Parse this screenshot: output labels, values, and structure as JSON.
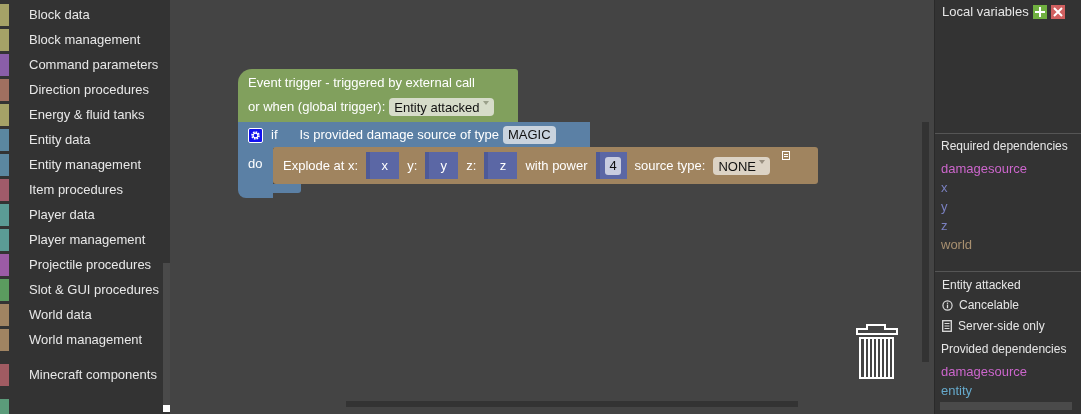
{
  "sidebar": {
    "groups": [
      {
        "categories": [
          {
            "label": "Block data",
            "color": "#a5a267"
          },
          {
            "label": "Block management",
            "color": "#a5a267"
          },
          {
            "label": "Command parameters",
            "color": "#8a5ea8"
          },
          {
            "label": "Direction procedures",
            "color": "#a07060"
          },
          {
            "label": "Energy & fluid tanks",
            "color": "#a5a267"
          },
          {
            "label": "Entity data",
            "color": "#5b87a0"
          },
          {
            "label": "Entity management",
            "color": "#5b87a0"
          },
          {
            "label": "Item procedures",
            "color": "#a05b6a"
          },
          {
            "label": "Player data",
            "color": "#5b9b95"
          },
          {
            "label": "Player management",
            "color": "#5b9b95"
          },
          {
            "label": "Projectile procedures",
            "color": "#9b5ba5"
          },
          {
            "label": "Slot & GUI procedures",
            "color": "#5b9b5f"
          },
          {
            "label": "World data",
            "color": "#a08462"
          },
          {
            "label": "World management",
            "color": "#a08462"
          }
        ]
      },
      {
        "categories": [
          {
            "label": "Minecraft components",
            "color": "#a05b62"
          }
        ]
      },
      {
        "categories": [
          {
            "color": "#5b9b7a"
          }
        ]
      }
    ]
  },
  "canvas": {
    "event_block": {
      "lines": [
        "Event trigger - triggered by external call",
        "or when (global trigger):"
      ],
      "trigger": "Entity attacked"
    },
    "if_block": {
      "keyword_if": "if",
      "condition": "Is provided damage source of type",
      "condition_value": "MAGIC",
      "keyword_do": "do"
    },
    "explode_block": {
      "segments": [
        {
          "kind": "label",
          "text": "Explode at x:"
        },
        {
          "kind": "input",
          "text": "x"
        },
        {
          "kind": "label",
          "text": "y:"
        },
        {
          "kind": "input",
          "text": "y"
        },
        {
          "kind": "label",
          "text": "z:"
        },
        {
          "kind": "input",
          "text": "z"
        },
        {
          "kind": "label",
          "text": "with power"
        },
        {
          "kind": "number",
          "text": "4"
        },
        {
          "kind": "label",
          "text": "source type:"
        },
        {
          "kind": "dropdown",
          "text": "NONE"
        }
      ]
    }
  },
  "right_panel": {
    "local_variables": {
      "title": "Local variables"
    },
    "required_dependencies": {
      "title": "Required dependencies",
      "items": [
        {
          "name": "damagesource",
          "color": "#cc66cc"
        },
        {
          "name": "x",
          "color": "#7a80c0"
        },
        {
          "name": "y",
          "color": "#7a80c0"
        },
        {
          "name": "z",
          "color": "#7a80c0"
        },
        {
          "name": "world",
          "color": "#a89070"
        }
      ]
    },
    "event_info": {
      "title": "Entity attacked",
      "flags": [
        {
          "kind": "info",
          "text": "Cancelable"
        },
        {
          "kind": "server",
          "text": "Server-side only"
        }
      ]
    },
    "provided_dependencies": {
      "title": "Provided dependencies",
      "items": [
        {
          "name": "damagesource",
          "color": "#cc66cc"
        },
        {
          "name": "entity",
          "color": "#66aacc"
        }
      ]
    }
  }
}
